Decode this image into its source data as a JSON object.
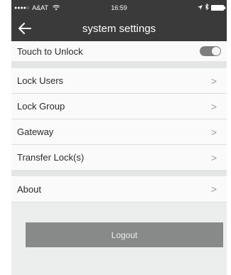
{
  "status_bar": {
    "carrier": "A&AT",
    "time": "16:59"
  },
  "header": {
    "title": "system settings"
  },
  "rows": {
    "touch_to_unlock": "Touch to Unlock",
    "lock_users": "Lock Users",
    "lock_group": "Lock Group",
    "gateway": "Gateway",
    "transfer_locks": "Transfer Lock(s)",
    "about": "About"
  },
  "toggle_state": "on",
  "chevron": ">",
  "logout_label": "Logout",
  "colors": {
    "header": "#3a3a3a",
    "background": "#eceeed",
    "button": "#888a89"
  }
}
